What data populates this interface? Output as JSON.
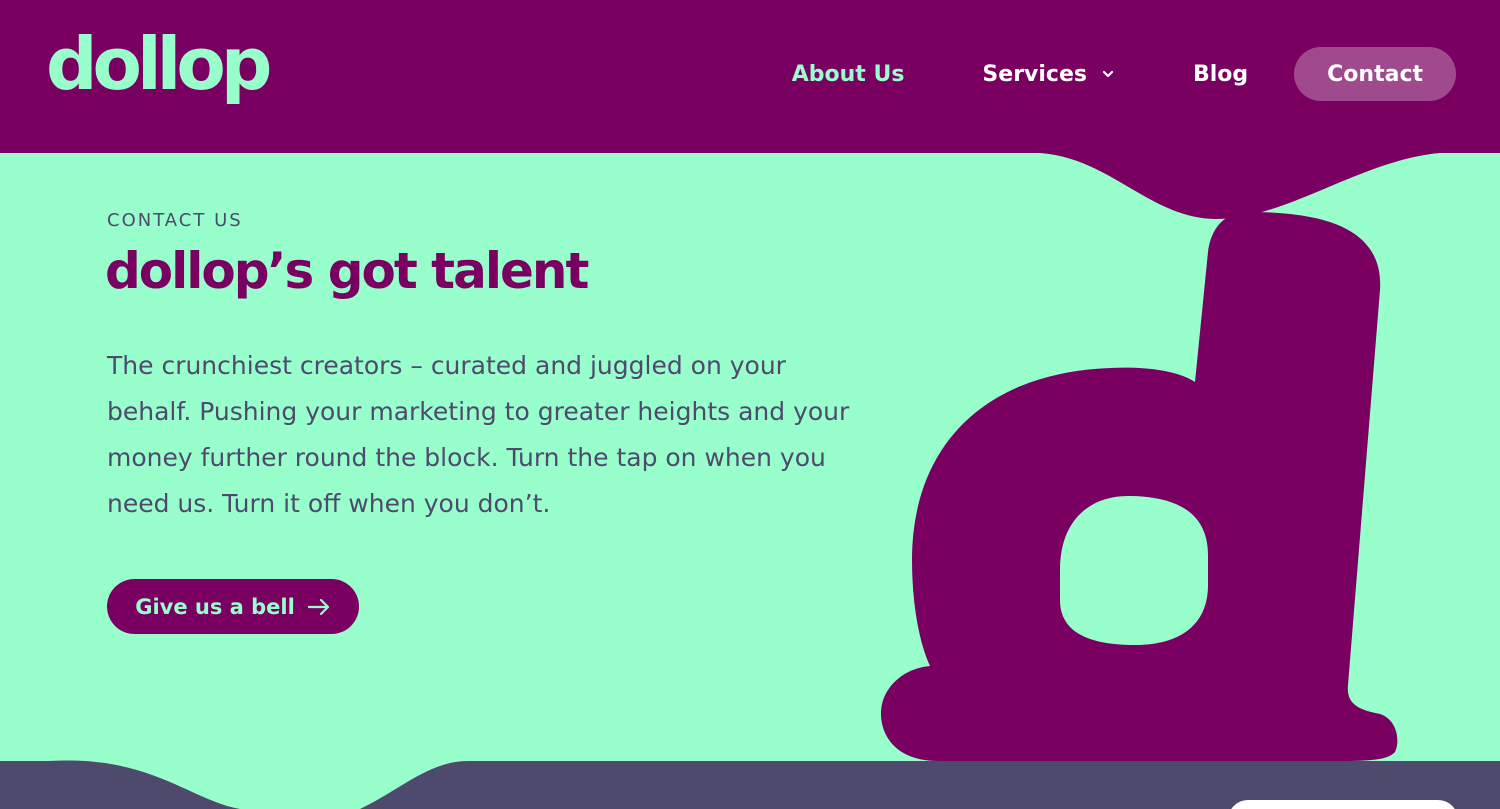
{
  "brand": {
    "logo_text": "dollop"
  },
  "nav": {
    "items": [
      {
        "label": "About Us",
        "active": true
      },
      {
        "label": "Services",
        "has_dropdown": true
      },
      {
        "label": "Blog"
      }
    ],
    "contact_label": "Contact"
  },
  "hero": {
    "eyebrow": "CONTACT US",
    "title": "dollop’s got talent",
    "body": "The crunchiest creators – curated and juggled on your behalf. Pushing your marketing to greater heights and your money further round the block. Turn the tap on when you need us. Turn it off when you don’t.",
    "cta_label": "Give us a bell"
  },
  "icons": {
    "dropdown": "chevron-down-icon",
    "cta": "arrow-right-icon"
  },
  "colors": {
    "primary": "#790061",
    "mint": "#98FECB",
    "slate": "#4D4A6E",
    "contact_button": "#9E4A8C",
    "white": "#ffffff"
  }
}
